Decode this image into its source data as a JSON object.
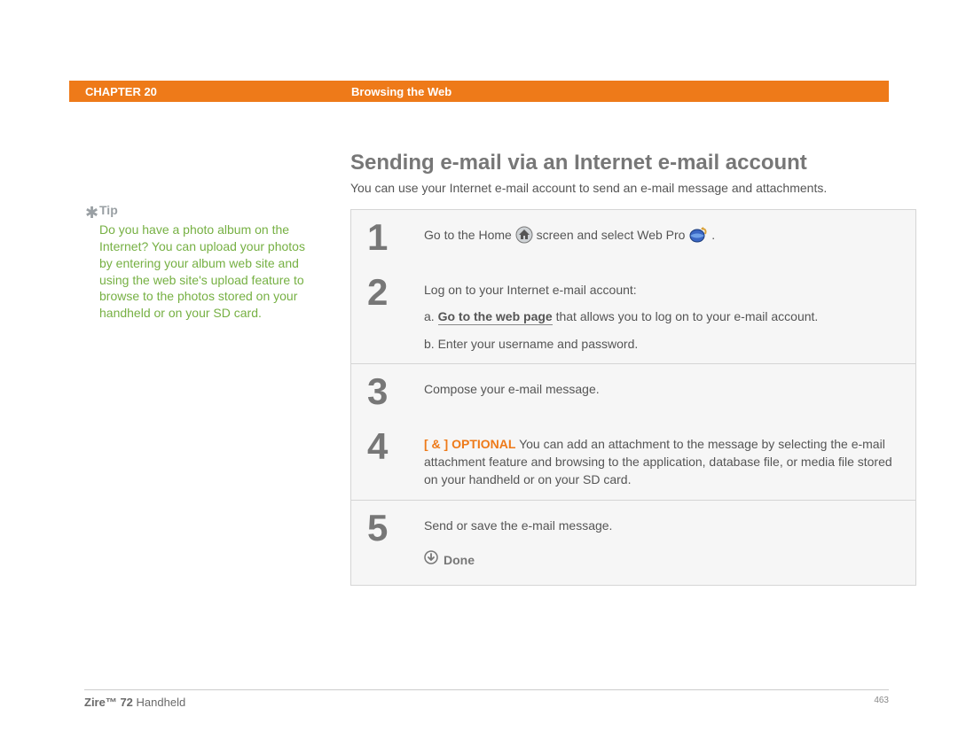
{
  "header": {
    "chapter": "CHAPTER 20",
    "title": "Browsing the Web"
  },
  "sidebar": {
    "tip_label": "Tip",
    "tip_text": "Do you have a photo album on the Internet? You can upload your photos by entering your album web site and using the web site's upload feature to browse to the photos stored on your handheld or on your SD card."
  },
  "main": {
    "title": "Sending e-mail via an Internet e-mail account",
    "subtitle": "You can use your Internet e-mail account to send an e-mail message and attachments.",
    "steps": {
      "s1": {
        "n": "1",
        "pre": "Go to the Home ",
        "mid": " screen and select Web Pro ",
        "post": " ."
      },
      "s2": {
        "n": "2",
        "intro": "Log on to your Internet e-mail account:",
        "a_prefix": "a.  ",
        "a_link": "Go to the web page",
        "a_rest": " that allows you to log on to your e-mail account.",
        "b": "b.  Enter your username and password."
      },
      "s3": {
        "n": "3",
        "text": "Compose your e-mail message."
      },
      "s4": {
        "n": "4",
        "opt": "[ & ]  OPTIONAL",
        "text": "   You can add an attachment to the message by selecting the e-mail attachment feature and browsing to the application, database file, or media file stored on your handheld or on your SD card."
      },
      "s5": {
        "n": "5",
        "text": "Send or save the e-mail message.",
        "done": "Done"
      }
    }
  },
  "footer": {
    "product_bold": "Zire™ 72",
    "product_rest": " Handheld",
    "page": "463"
  }
}
